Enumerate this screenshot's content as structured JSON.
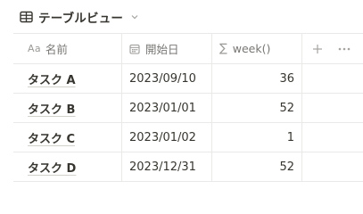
{
  "view": {
    "title": "テーブルビュー",
    "icon": "table-icon"
  },
  "columns": [
    {
      "label": "名前",
      "type_label": "Aa",
      "icon": "title-icon"
    },
    {
      "label": "開始日",
      "icon": "calendar-icon"
    },
    {
      "label": "week()",
      "type_label": "∑",
      "icon": "formula-icon"
    }
  ],
  "rows": [
    {
      "name": "タスク A",
      "start": "2023/09/10",
      "week": "36"
    },
    {
      "name": "タスク B",
      "start": "2023/01/01",
      "week": "52"
    },
    {
      "name": "タスク C",
      "start": "2023/01/02",
      "week": "1"
    },
    {
      "name": "タスク D",
      "start": "2023/12/31",
      "week": "52"
    }
  ],
  "controls": {
    "add_property_icon": "plus-icon",
    "more_icon": "more-horizontal-icon",
    "view_dropdown_icon": "chevron-down-icon"
  },
  "colors": {
    "text": "#37352f",
    "muted": "#787774",
    "border": "#e9e9e7"
  }
}
